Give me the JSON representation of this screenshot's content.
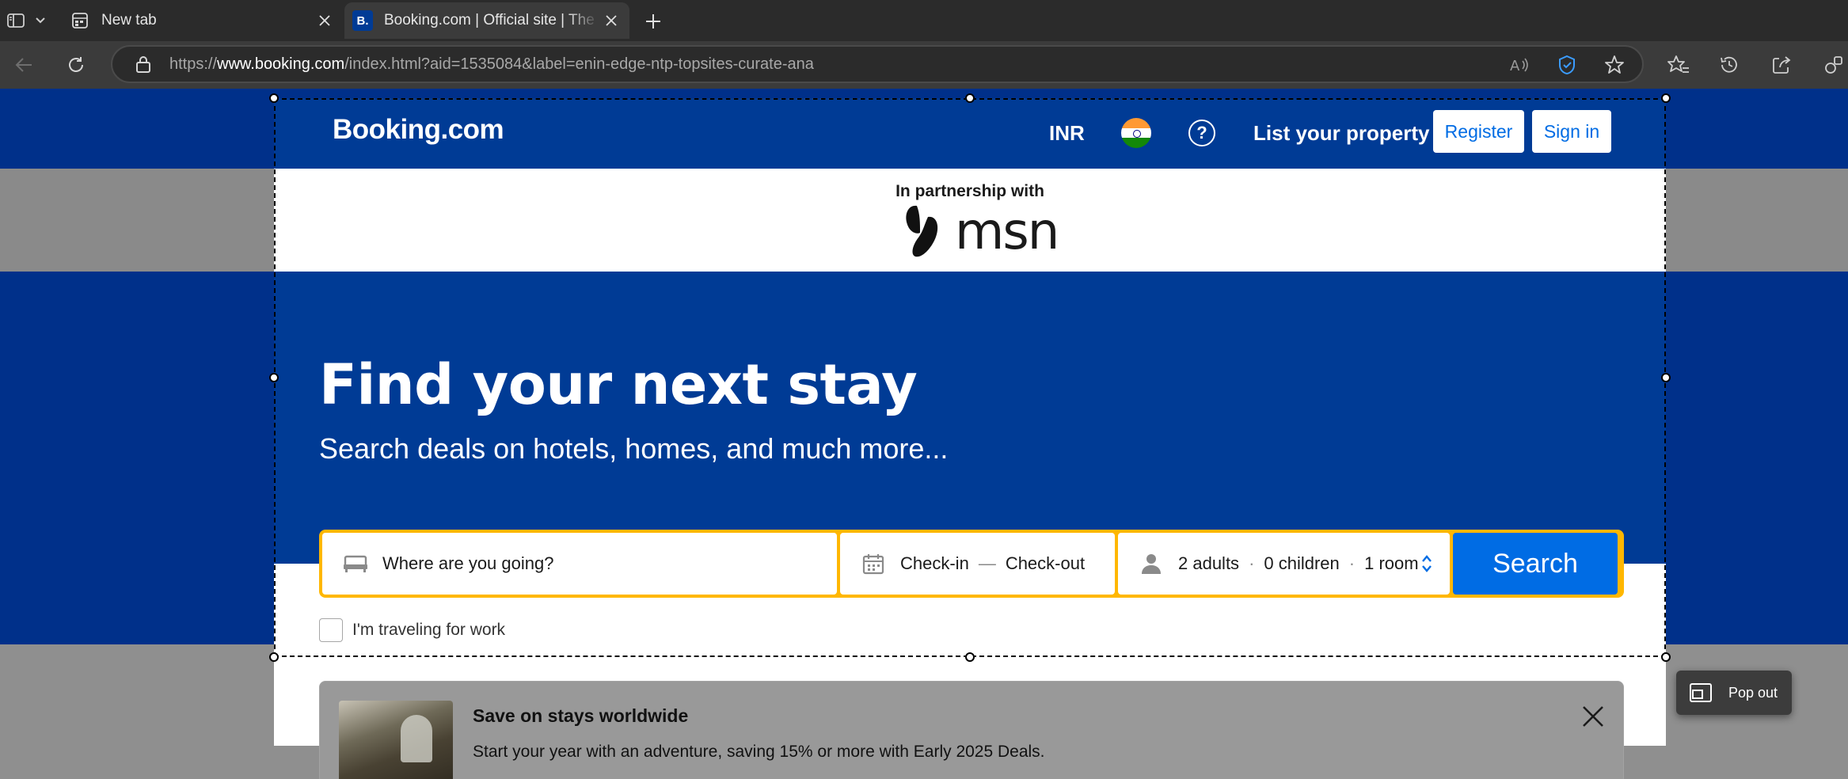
{
  "browser": {
    "tabs": [
      {
        "title": "New tab",
        "icon": "new-tab-page-icon"
      },
      {
        "title": "Booking.com | Official site | The best hotels, flights, car rentals & accommodations",
        "icon": "booking-favicon",
        "favicon_text": "B."
      }
    ],
    "address": {
      "scheme": "https://",
      "host": "www.booking.com",
      "path": "/index.html?aid=1535084&label=enin-edge-ntp-topsites-curate-ana"
    }
  },
  "page": {
    "logo": "Booking.com",
    "header": {
      "currency": "INR",
      "help_symbol": "?",
      "list_property": "List your property",
      "register": "Register",
      "sign_in": "Sign in"
    },
    "partnership": {
      "label": "In partnership with",
      "brand": "msn"
    },
    "hero": {
      "title": "Find your next stay",
      "subtitle": "Search deals on hotels, homes, and much more..."
    },
    "search": {
      "destination_placeholder": "Where are you going?",
      "check_in": "Check-in",
      "dash": "—",
      "check_out": "Check-out",
      "guests": {
        "adults": "2 adults",
        "children": "0 children",
        "rooms": "1 room",
        "dot": "·"
      },
      "button": "Search"
    },
    "work_travel": {
      "label": "I'm traveling for work",
      "checked": false
    },
    "promo": {
      "title": "Save on stays worldwide",
      "text": "Start your year with an adventure, saving 15% or more with Early 2025 Deals."
    },
    "popout": {
      "label": "Pop out"
    }
  },
  "colors": {
    "brand_blue": "#003b95",
    "accent_yellow": "#ffb700",
    "action_blue": "#006ce4"
  }
}
